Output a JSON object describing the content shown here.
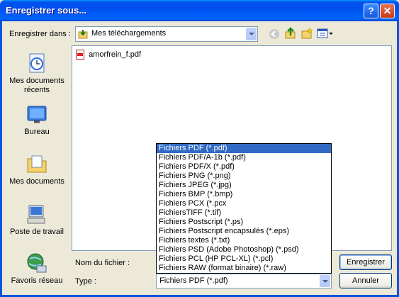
{
  "window": {
    "title": "Enregistrer sous..."
  },
  "titlebar_buttons": {
    "help": "?",
    "close": "✕"
  },
  "save_in": {
    "label": "Enregistrer dans :",
    "value": "Mes téléchargements"
  },
  "places": [
    {
      "label": "Mes documents récents",
      "icon": "recent-documents-icon"
    },
    {
      "label": "Bureau",
      "icon": "desktop-icon"
    },
    {
      "label": "Mes documents",
      "icon": "my-documents-icon"
    },
    {
      "label": "Poste de travail",
      "icon": "my-computer-icon"
    },
    {
      "label": "Favoris réseau",
      "icon": "network-places-icon"
    }
  ],
  "files": [
    {
      "name": "amorfrein_f.pdf",
      "icon": "pdf-file-icon"
    }
  ],
  "filename": {
    "label": "Nom du fichier :",
    "value": ""
  },
  "type": {
    "label": "Type :",
    "value": "Fichiers PDF (*.pdf)"
  },
  "type_options": [
    "Fichiers PDF (*.pdf)",
    "Fichiers PDF/A-1b (*.pdf)",
    "Fichiers PDF/X (*.pdf)",
    "Fichiers PNG (*.png)",
    "Fichiers JPEG (*.jpg)",
    "Fichiers BMP (*.bmp)",
    "Fichiers PCX (*.pcx",
    "FichiersTIFF (*.tif)",
    "Fichiers Postscript (*.ps)",
    "Fichiers Postscript encapsulés (*.eps)",
    "Fichiers textes (*.txt)",
    "Fichiers PSD (Adobe Photoshop) (*.psd)",
    "Fichiers PCL (HP PCL-XL) (*.pcl)",
    "Fichiers RAW (format binaire) (*.raw)"
  ],
  "buttons": {
    "save": "Enregistrer",
    "cancel": "Annuler"
  },
  "colors": {
    "titlebar": "#0054e3",
    "selection": "#316ac5",
    "dialog_bg": "#ece9d8"
  }
}
